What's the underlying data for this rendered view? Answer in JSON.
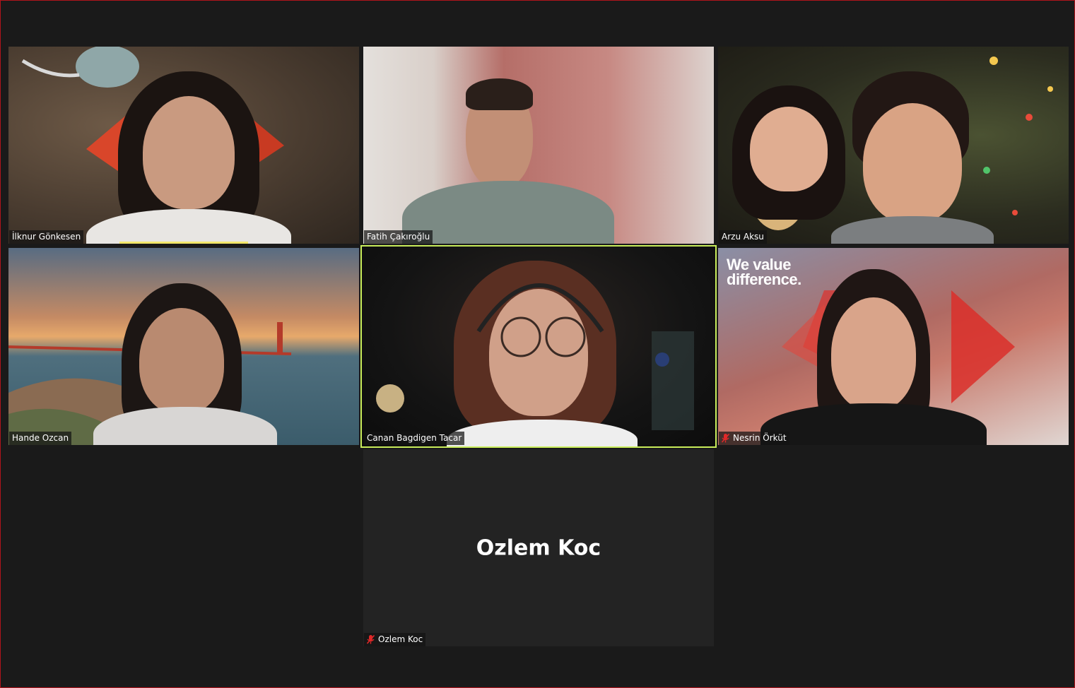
{
  "meeting": {
    "colors": {
      "background": "#1a1a1a",
      "tile_background": "#232323",
      "active_speaker_border": "#c8ec5a",
      "audio_level": "#f3e86b",
      "muted_icon": "#e02828",
      "window_border": "#b0141b"
    },
    "participants": [
      {
        "name": "İlknur Gönkesen",
        "video": true,
        "muted": false,
        "audio_active": true
      },
      {
        "name": "Fatih Çakıroğlu",
        "video": true,
        "muted": false
      },
      {
        "name": "Arzu Aksu",
        "video": true,
        "muted": false
      },
      {
        "name": "Hande Ozcan",
        "video": true,
        "muted": false
      },
      {
        "name": "Canan Bagdigen Tacar",
        "video": true,
        "muted": false,
        "active_speaker": true
      },
      {
        "name": "Nesrin Örküt",
        "video": true,
        "muted": true,
        "background_text": "We value difference."
      },
      {
        "name": "Ozlem Koc",
        "video": false,
        "muted": true,
        "display_name_large": "Ozlem Koc"
      }
    ]
  }
}
